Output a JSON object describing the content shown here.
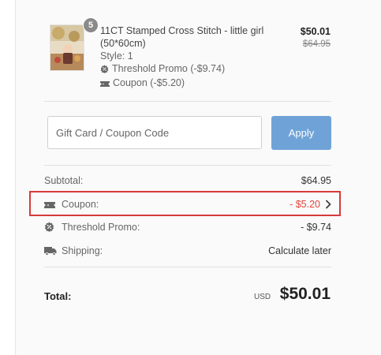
{
  "product": {
    "quantity_badge": "5",
    "name": "11CT Stamped Cross Stitch - little girl",
    "size": "(50*60cm)",
    "style": "Style: 1",
    "threshold_promo": "Threshold Promo (-$9.74)",
    "coupon": "Coupon (-$5.20)",
    "price": "$50.01",
    "original_price": "$64.95"
  },
  "coupon_form": {
    "placeholder": "Gift Card / Coupon Code",
    "apply_label": "Apply"
  },
  "summary": {
    "subtotal_label": "Subtotal:",
    "subtotal_value": "$64.95",
    "coupon_label": "Coupon:",
    "coupon_value": "- $5.20",
    "promo_label": "Threshold Promo:",
    "promo_value": "- $9.74",
    "shipping_label": "Shipping:",
    "shipping_value": "Calculate later",
    "total_label": "Total:",
    "total_currency": "USD",
    "total_value": "$50.01"
  },
  "colors": {
    "apply_button": "#6fa3d8",
    "discount_red": "#e0463d",
    "highlight_border": "#d83a3a"
  }
}
